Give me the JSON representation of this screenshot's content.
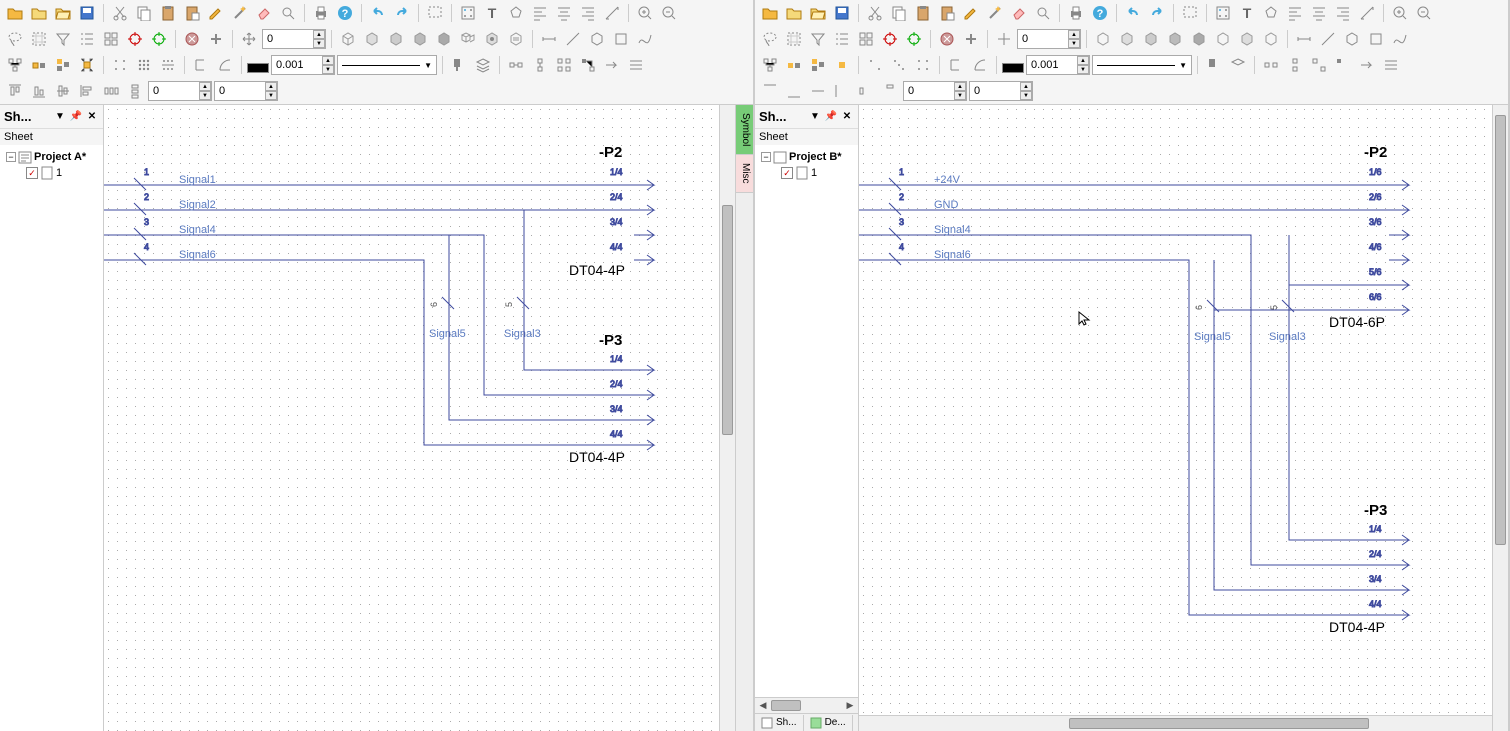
{
  "left": {
    "sidepanel_title": "Sh...",
    "tree_header": "Sheet",
    "project_name": "Project A*",
    "sheet_name": "1",
    "spin1": "0",
    "spin2": "0.001",
    "spin3": "0",
    "spin4": "0",
    "schematic": {
      "p2": {
        "ref": "-P2",
        "type": "DT04-4P",
        "pins": [
          "1/4",
          "2/4",
          "3/4",
          "4/4"
        ]
      },
      "p3": {
        "ref": "-P3",
        "type": "DT04-4P",
        "pins": [
          "1/4",
          "2/4",
          "3/4",
          "4/4"
        ]
      },
      "signals": [
        "Signal1",
        "Signal2",
        "Signal4",
        "Signal6"
      ],
      "drop_signals": {
        "left": "Signal5",
        "right": "Signal3"
      },
      "left_pins": [
        "1",
        "2",
        "3",
        "4"
      ],
      "drop_pins": {
        "left": "6",
        "right": "5"
      }
    }
  },
  "right": {
    "sidepanel_title": "Sh...",
    "tree_header": "Sheet",
    "project_name": "Project B*",
    "sheet_name": "1",
    "spin1": "0",
    "spin2": "0.001",
    "spin3": "0",
    "spin4": "0",
    "tabs_bottom": {
      "sh": "Sh...",
      "de": "De..."
    },
    "side_tabs": {
      "symbol": "Symbol",
      "misc": "Misc"
    },
    "schematic": {
      "p2": {
        "ref": "-P2",
        "type": "DT04-6P",
        "pins": [
          "1/6",
          "2/6",
          "3/6",
          "4/6",
          "5/6",
          "6/6"
        ]
      },
      "p3": {
        "ref": "-P3",
        "type": "DT04-4P",
        "pins": [
          "1/4",
          "2/4",
          "3/4",
          "4/4"
        ]
      },
      "signals": [
        "+24V",
        "GND",
        "Signal4",
        "Signal6"
      ],
      "drop_signals": {
        "left": "Signal5",
        "right": "Signal3"
      },
      "left_pins": [
        "1",
        "2",
        "3",
        "4"
      ],
      "drop_pins": {
        "left": "6",
        "right": "5"
      }
    }
  }
}
